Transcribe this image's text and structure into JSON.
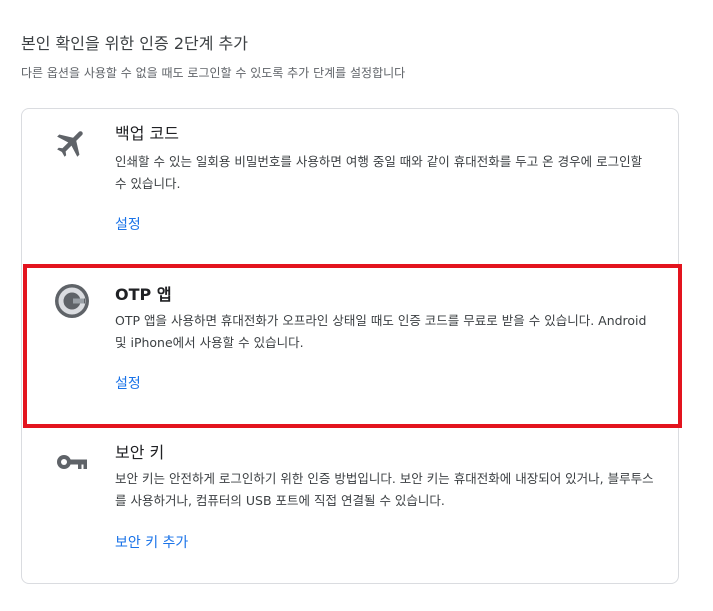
{
  "page": {
    "title": "본인 확인을 위한 인증 2단계 추가",
    "subtitle": "다른 옵션을 사용할 수 없을 때도 로그인할 수 있도록 추가 단계를 설정합니다"
  },
  "options": [
    {
      "icon": "airplane-icon",
      "title": "백업 코드",
      "description": "인쇄할 수 있는 일회용 비밀번호를 사용하면 여행 중일 때와 같이 휴대전화를 두고 온 경우에 로그인할 수 있습니다.",
      "link": "설정"
    },
    {
      "icon": "google-authenticator-icon",
      "title": "OTP 앱",
      "description": "OTP 앱을 사용하면 휴대전화가 오프라인 상태일 때도 인증 코드를 무료로 받을 수 있습니다. Android 및 iPhone에서 사용할 수 있습니다.",
      "link": "설정"
    },
    {
      "icon": "key-icon",
      "title": "보안 키",
      "description": "보안 키는 안전하게 로그인하기 위한 인증 방법입니다. 보안 키는 휴대전화에 내장되어 있거나, 블루투스를 사용하거나, 컴퓨터의 USB 포트에 직접 연결될 수 있습니다.",
      "link": "보안 키 추가"
    }
  ],
  "colors": {
    "link": "#1a73e8",
    "highlight": "#e3141e",
    "icon": "#5f6368"
  }
}
